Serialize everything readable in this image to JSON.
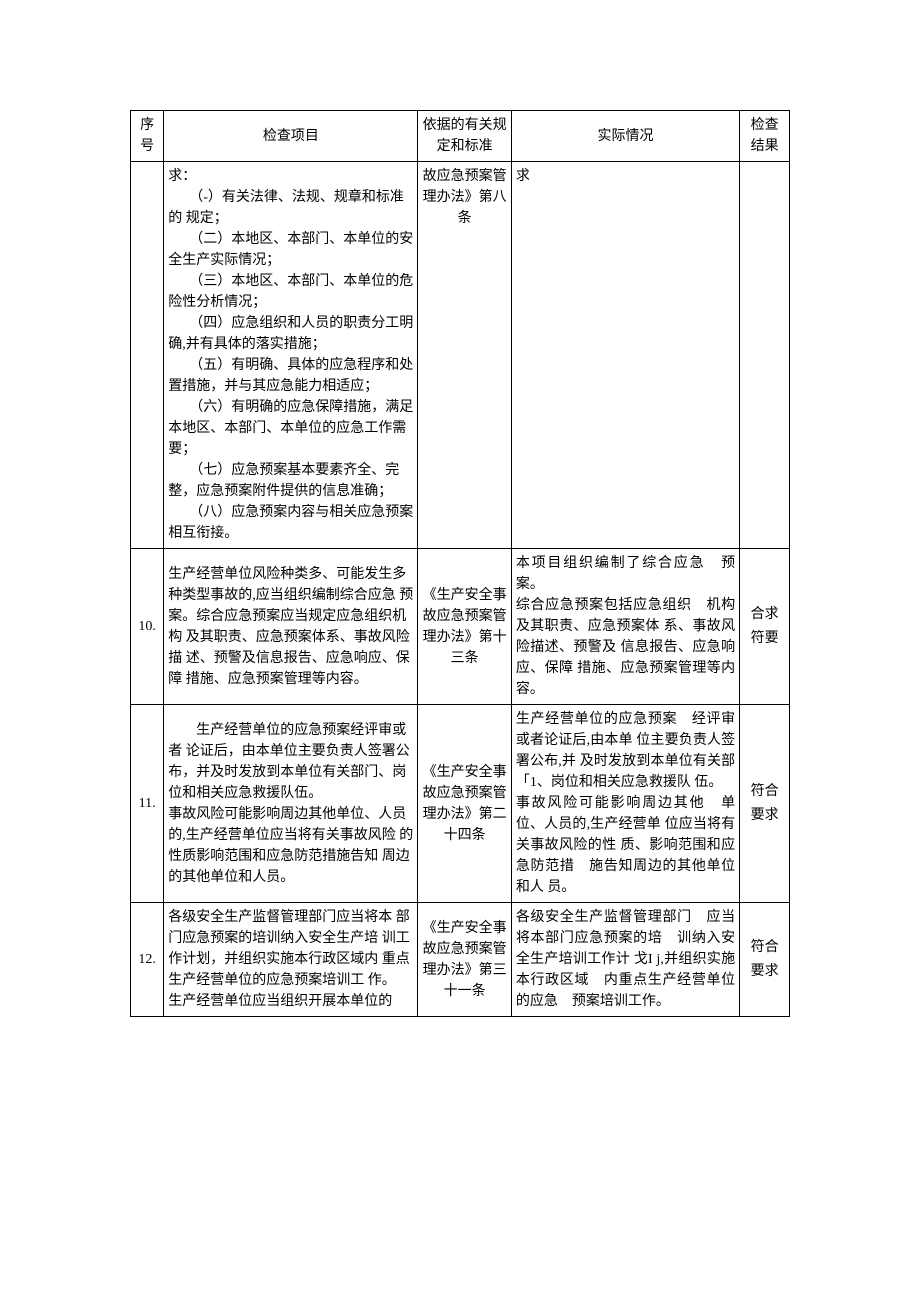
{
  "header": {
    "num": "序号",
    "item": "检查项目",
    "basis": "依据的有关规定和标准",
    "situation": "实际情况",
    "result": "检查 结果"
  },
  "rows": {
    "r0": {
      "item_lines": [
        "求：",
        "　　（-）有关法律、法规、规章和标准的 规定；",
        "　　（二）本地区、本部门、本单位的安全生产实际情况；",
        "　　（三）本地区、本部门、本单位的危险性分析情况；",
        "　　（四）应急组织和人员的职责分工明 确,并有具体的落实措施；",
        "　　（五）有明确、具体的应急程序和处置措施，并与其应急能力相适应；",
        "　　（六）有明确的应急保障措施，满足本地区、本部门、本单位的应急工作需要；",
        "　　（七）应急预案基本要素齐全、完整，应急预案附件提供的信息准确；",
        "　　（八）应急预案内容与相关应急预案相互衔接。"
      ],
      "basis": "故应急预案管理办法》第八条",
      "situation": "求",
      "result": ""
    },
    "r10": {
      "num": "10.",
      "item": "生产经营单位风险种类多、可能发生多 种类型事故的,应当组织编制综合应急 预案。综合应急预案应当规定应急组织机构 及其职责、应急预案体系、事故风险描 述、预警及信息报告、应急响应、保障 措施、应急预案管理等内容。",
      "basis": "《生产安全事故应急预案管理办法》第十三条",
      "situation": "本项目组织编制了综合应急　预案。\n综合应急预案包括应急组织　机构及其职责、应急预案体 系、事故风险描述、预警及 信息报告、应急响应、保障 措施、应急预案管理等内容。",
      "result": "合求符要"
    },
    "r11": {
      "num": "11.",
      "item_p1": "　　生产经营单位的应急预案经评审或者 论证后，由本单位主要负责人签署公 布，并及时发放到本单位有关部门、岗 位和相关应急救援队伍。",
      "item_p2": "事故风险可能影响周边其他单位、人员 的,生产经营单位应当将有关事故风险 的性质影响范围和应急防范措施告知 周边的其他单位和人员。",
      "basis": "《生产安全事故应急预案管理办法》第二十四条",
      "situation": " 生产经营单位的应急预案　经评审或者论证后,由本单 位主要负责人签署公布,并 及时发放到本单位有关部　「1、岗位和相关应急救援队 伍。\n事故风险可能影响周边其他　单位、人员的,生产经营单 位应当将有关事故风险的性 质、影响范围和应急防范措　施告知周边的其他单位和人 员。",
      "result": "符合要求"
    },
    "r12": {
      "num": "12.",
      "item": "各级安全生产监督管理部门应当将本 部门应急预案的培训纳入安全生产培 训工作计划，并组织实施本行政区域内 重点生产经营单位的应急预案培训工 作。\n生产经营单位应当组织开展本单位的",
      "basis": "《生产安全事故应急预案管理办法》第三十一条",
      "situation": "各级安全生产监督管理部门　应当将本部门应急预案的培　训纳入安全生产培训工作计 戈I j,并组织实施本行政区域　内重点生产经营单位的应急　预案培训工作。",
      "result": "符合 要求"
    }
  }
}
